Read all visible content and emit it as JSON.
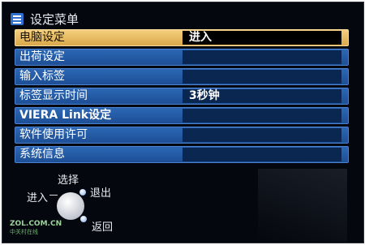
{
  "header": {
    "title": "设定菜单",
    "icon": "menu-list-icon"
  },
  "menu": {
    "items": [
      {
        "label": "电脑设定",
        "value": "进入",
        "selected": true
      },
      {
        "label": "出荷设定",
        "value": ""
      },
      {
        "label": "输入标签",
        "value": ""
      },
      {
        "label": "标签显示时间",
        "value": "3秒钟"
      },
      {
        "label": "VIERA Link设定",
        "value": ""
      },
      {
        "label": "软件使用许可",
        "value": ""
      },
      {
        "label": "系统信息",
        "value": ""
      }
    ],
    "colors": {
      "selected_row": "#e8bb5e",
      "normal_row": "#2459a3",
      "value_box": "#0a2752"
    }
  },
  "nav_guide": {
    "select": "选择",
    "enter": "进入",
    "back": "退出",
    "return": "返回",
    "icon": "dpad-icon"
  },
  "watermark": {
    "site": "ZOL.COM.CN",
    "sub": "中关村在线"
  }
}
